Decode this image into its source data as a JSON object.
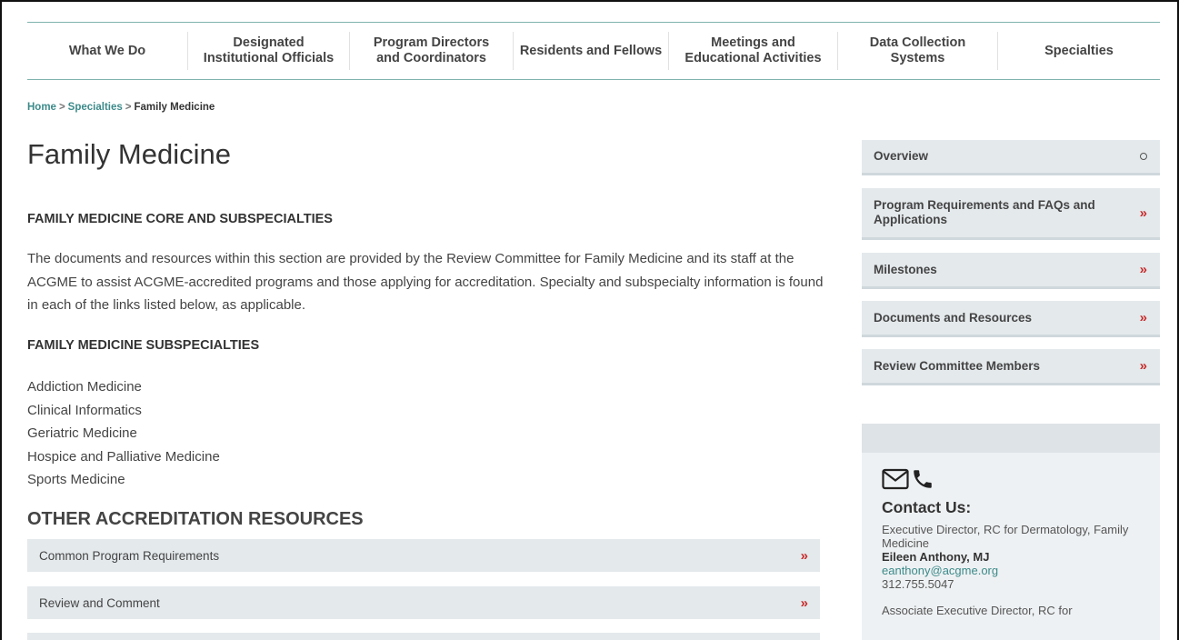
{
  "nav": {
    "items": [
      {
        "label": "What We Do"
      },
      {
        "label": "Designated\nInstitutional Officials"
      },
      {
        "label": "Program Directors\nand Coordinators"
      },
      {
        "label": "Residents and Fellows"
      },
      {
        "label": "Meetings and\nEducational Activities"
      },
      {
        "label": "Data Collection\nSystems"
      },
      {
        "label": "Specialties"
      }
    ]
  },
  "breadcrumb": {
    "home": "Home",
    "separator": ">",
    "specialties": "Specialties",
    "current": "Family Medicine"
  },
  "main": {
    "title": "Family Medicine",
    "core_heading": "FAMILY MEDICINE CORE AND SUBSPECIALTIES",
    "intro": "The documents and resources within this section are provided by the Review Committee for Family Medicine and its staff at the ACGME to assist ACGME-accredited programs and those applying for accreditation. Specialty and subspecialty information is found in each of the links listed below, as applicable.",
    "subspecialties_heading": "FAMILY MEDICINE SUBSPECIALTIES",
    "subspecialties": [
      "Addiction Medicine",
      "Clinical Informatics",
      "Geriatric Medicine",
      "Hospice and Palliative Medicine",
      "Sports Medicine"
    ],
    "other_heading": "OTHER ACCREDITATION RESOURCES",
    "resources": [
      {
        "label": "Common Program Requirements"
      },
      {
        "label": "Review and Comment"
      },
      {
        "label": ""
      }
    ],
    "chevron": "»"
  },
  "sidebar": {
    "items": [
      {
        "label": "Overview",
        "icon": "circle-icon"
      },
      {
        "label": "Program Requirements and FAQs and Applications",
        "icon": "chevron-double-right-icon"
      },
      {
        "label": "Milestones",
        "icon": "chevron-double-right-icon"
      },
      {
        "label": "Documents and Resources",
        "icon": "chevron-double-right-icon"
      },
      {
        "label": "Review Committee Members",
        "icon": "chevron-double-right-icon"
      }
    ],
    "chevron": "»",
    "contact": {
      "title": "Contact Us:",
      "role": "Executive Director, RC for Dermatology, Family Medicine",
      "name": "Eileen Anthony, MJ",
      "email": "eanthony@acgme.org",
      "phone": "312.755.5047",
      "role2": "Associate Executive Director, RC for",
      "icons": [
        "envelope-icon",
        "phone-icon"
      ]
    }
  },
  "colors": {
    "accent": "#3d8a8a",
    "chevron": "#c62a2a",
    "panel": "#e4e9ec",
    "nav_rule": "#7fb3ad"
  }
}
